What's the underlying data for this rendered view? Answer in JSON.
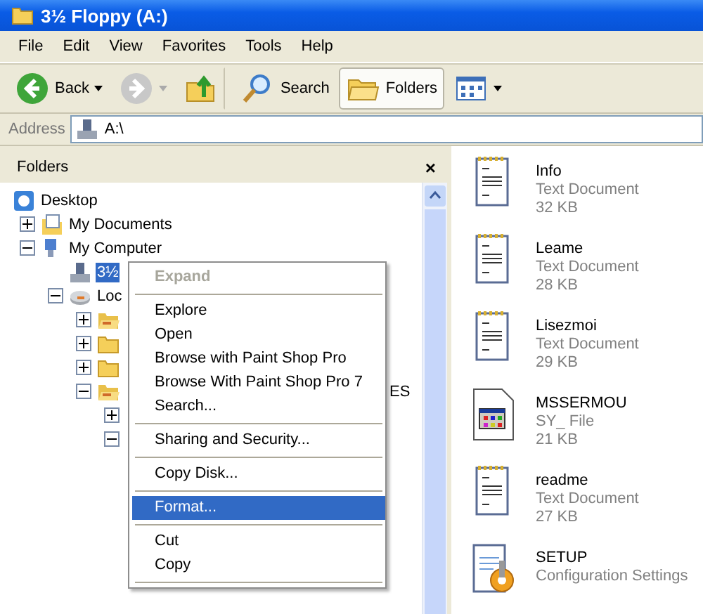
{
  "window": {
    "title": "3½ Floppy (A:)"
  },
  "menu_bar": [
    "File",
    "Edit",
    "View",
    "Favorites",
    "Tools",
    "Help"
  ],
  "toolbar": [
    {
      "kind": "back",
      "label": "Back",
      "disabled": false
    },
    {
      "kind": "forward",
      "disabled": true
    },
    {
      "kind": "up"
    },
    {
      "kind": "search",
      "label": "Search",
      "selected": false
    },
    {
      "kind": "folders",
      "label": "Folders",
      "selected": true
    },
    {
      "kind": "views"
    }
  ],
  "address_bar": {
    "label": "Address",
    "value": "A:\\"
  },
  "folders_pane": {
    "title": "Folders",
    "close": "×",
    "tree": [
      {
        "label": "Desktop",
        "kind": "desktop",
        "selected": false,
        "children": [
          {
            "label": "My Documents",
            "kind": "documents",
            "expanded": false,
            "selected": false
          },
          {
            "label": "My Computer",
            "kind": "computer",
            "expanded": true,
            "selected": false,
            "children": [
              {
                "label": "3½",
                "kind": "floppy",
                "selected": true
              },
              {
                "label": "Loc",
                "kind": "disk",
                "expanded": true,
                "selected": false,
                "children": [
                  {
                    "kind": "folder-open",
                    "expanded": false
                  },
                  {
                    "kind": "folder",
                    "expanded": false
                  },
                  {
                    "kind": "folder",
                    "expanded": false
                  },
                  {
                    "label": "ES",
                    "kind": "folder-open",
                    "expanded": true,
                    "selected": false,
                    "children": [
                      {
                        "expanded": false
                      },
                      {
                        "expanded": true
                      }
                    ]
                  }
                ]
              }
            ]
          }
        ]
      }
    ]
  },
  "context_menu": [
    {
      "kind": "item",
      "label": "Expand",
      "disabled": true,
      "selected": false
    },
    {
      "kind": "separator"
    },
    {
      "kind": "item",
      "label": "Explore",
      "disabled": false,
      "selected": false
    },
    {
      "kind": "item",
      "label": "Open",
      "disabled": false,
      "selected": false
    },
    {
      "kind": "item",
      "label": "Browse with Paint Shop Pro",
      "disabled": false,
      "selected": false
    },
    {
      "kind": "item",
      "label": "Browse With Paint Shop Pro 7",
      "disabled": false,
      "selected": false
    },
    {
      "kind": "item",
      "label": "Search...",
      "disabled": false,
      "selected": false
    },
    {
      "kind": "separator"
    },
    {
      "kind": "item",
      "label": "Sharing and Security...",
      "disabled": false,
      "selected": false
    },
    {
      "kind": "separator"
    },
    {
      "kind": "item",
      "label": "Copy Disk...",
      "disabled": false,
      "selected": false
    },
    {
      "kind": "separator"
    },
    {
      "kind": "item",
      "label": "Format...",
      "disabled": false,
      "selected": true
    },
    {
      "kind": "separator"
    },
    {
      "kind": "item",
      "label": "Cut",
      "disabled": false,
      "selected": false
    },
    {
      "kind": "item",
      "label": "Copy",
      "disabled": false,
      "selected": false
    },
    {
      "kind": "separator"
    }
  ],
  "files": [
    {
      "name": "Info",
      "type": "Text Document",
      "size": "32 KB",
      "kind": "text"
    },
    {
      "name": "Leame",
      "type": "Text Document",
      "size": "28 KB",
      "kind": "text"
    },
    {
      "name": "Lisezmoi",
      "type": "Text Document",
      "size": "29 KB",
      "kind": "text"
    },
    {
      "name": "MSSERMOU",
      "type": "SY_ File",
      "size": "21 KB",
      "kind": "system"
    },
    {
      "name": "readme",
      "type": "Text Document",
      "size": "27 KB",
      "kind": "text"
    },
    {
      "name": "SETUP",
      "type": "Configuration Settings",
      "kind": "config"
    }
  ]
}
